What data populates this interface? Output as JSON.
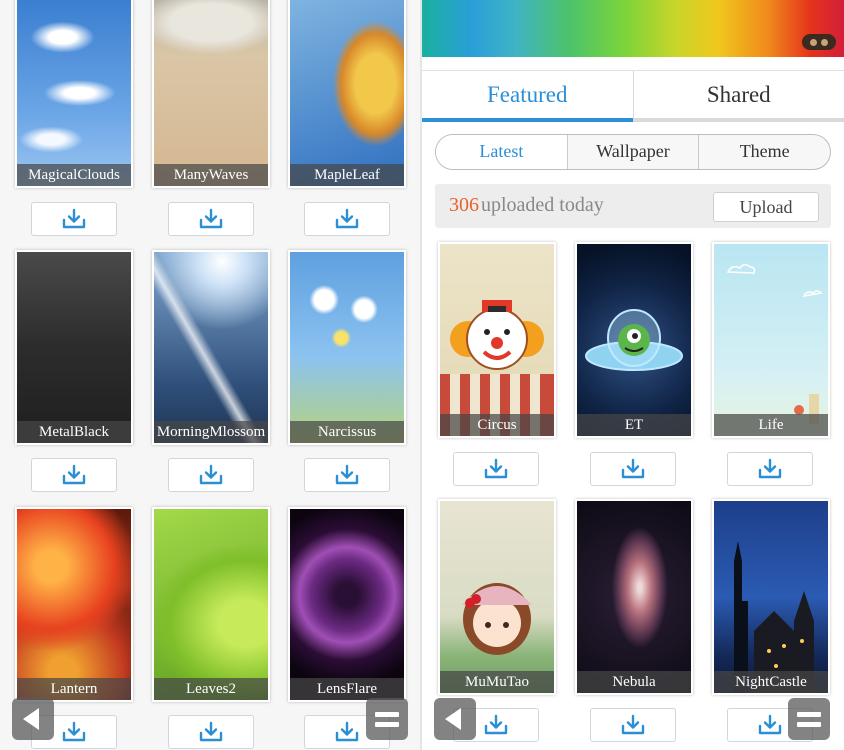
{
  "left": {
    "wallpapers": [
      {
        "name": "MagicalClouds",
        "art": "a-clouds"
      },
      {
        "name": "ManyWaves",
        "art": "a-waves"
      },
      {
        "name": "MapleLeaf",
        "art": "a-maple"
      },
      {
        "name": "MetalBlack",
        "art": "a-metal"
      },
      {
        "name": "MorningMlossom",
        "art": "a-morning"
      },
      {
        "name": "Narcissus",
        "art": "a-narcissus"
      },
      {
        "name": "Lantern",
        "art": "a-lantern"
      },
      {
        "name": "Leaves2",
        "art": "a-leaves"
      },
      {
        "name": "LensFlare",
        "art": "a-lens"
      }
    ]
  },
  "right": {
    "tabs": {
      "featured": "Featured",
      "shared": "Shared"
    },
    "segments": {
      "latest": "Latest",
      "wallpaper": "Wallpaper",
      "theme": "Theme"
    },
    "upload": {
      "count": "306",
      "text": "uploaded today",
      "button": "Upload"
    },
    "themes": [
      {
        "name": "Circus",
        "art": "a-circus"
      },
      {
        "name": "ET",
        "art": "a-et"
      },
      {
        "name": "Life",
        "art": "a-life"
      },
      {
        "name": "MuMuTao",
        "art": "a-mumu"
      },
      {
        "name": "Nebula",
        "art": "a-nebula"
      },
      {
        "name": "NightCastle",
        "art": "a-night"
      }
    ]
  },
  "icons": {
    "download": "download-icon",
    "back": "back-arrow-icon",
    "menu": "menu-icon",
    "more": "more-dots-icon"
  },
  "colors": {
    "accent": "#2b8fd6",
    "upload_count": "#e8632a"
  }
}
